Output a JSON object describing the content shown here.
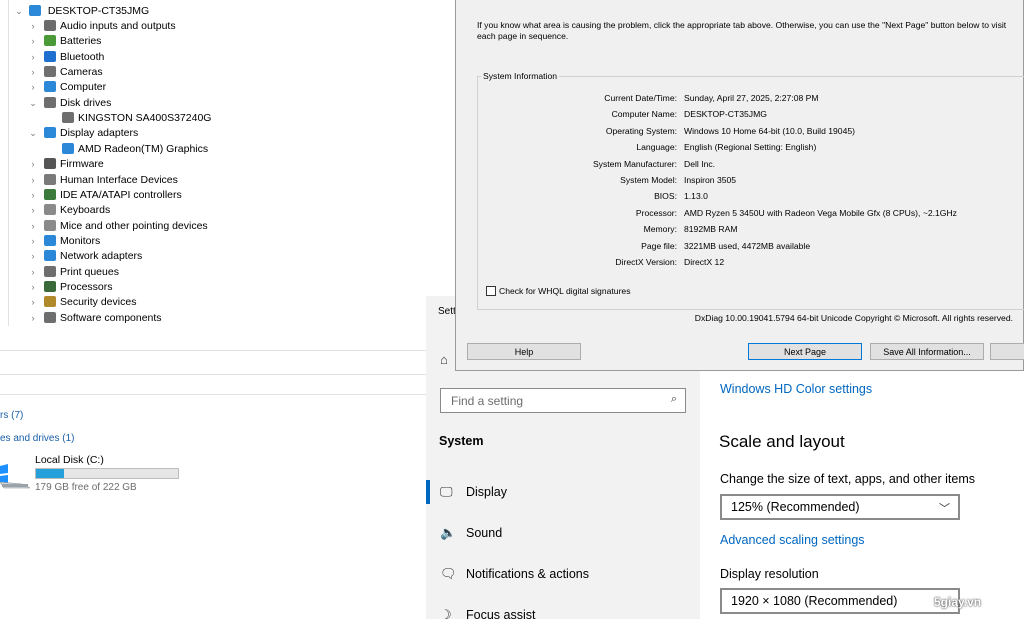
{
  "device_manager": {
    "root": "DESKTOP-CT35JMG",
    "items": [
      {
        "label": "Audio inputs and outputs",
        "chev": "›",
        "indent": 0,
        "color": "#6b6b6b"
      },
      {
        "label": "Batteries",
        "chev": "›",
        "indent": 0,
        "color": "#4a9a3a"
      },
      {
        "label": "Bluetooth",
        "chev": "›",
        "indent": 0,
        "color": "#1f6fd1"
      },
      {
        "label": "Cameras",
        "chev": "›",
        "indent": 0,
        "color": "#707070"
      },
      {
        "label": "Computer",
        "chev": "›",
        "indent": 0,
        "color": "#2b88d8"
      },
      {
        "label": "Disk drives",
        "chev": "⌄",
        "indent": 0,
        "color": "#6e6e6e"
      },
      {
        "label": "KINGSTON SA400S37240G",
        "chev": "",
        "indent": 1,
        "color": "#6e6e6e"
      },
      {
        "label": "Display adapters",
        "chev": "⌄",
        "indent": 0,
        "color": "#2b88d8"
      },
      {
        "label": "AMD Radeon(TM) Graphics",
        "chev": "",
        "indent": 1,
        "color": "#2b88d8"
      },
      {
        "label": "Firmware",
        "chev": "›",
        "indent": 0,
        "color": "#555555"
      },
      {
        "label": "Human Interface Devices",
        "chev": "›",
        "indent": 0,
        "color": "#7a7a7a"
      },
      {
        "label": "IDE ATA/ATAPI controllers",
        "chev": "›",
        "indent": 0,
        "color": "#3a7a3a"
      },
      {
        "label": "Keyboards",
        "chev": "›",
        "indent": 0,
        "color": "#8a8a8a"
      },
      {
        "label": "Mice and other pointing devices",
        "chev": "›",
        "indent": 0,
        "color": "#8a8a8a"
      },
      {
        "label": "Monitors",
        "chev": "›",
        "indent": 0,
        "color": "#2b88d8"
      },
      {
        "label": "Network adapters",
        "chev": "›",
        "indent": 0,
        "color": "#2b88d8"
      },
      {
        "label": "Print queues",
        "chev": "›",
        "indent": 0,
        "color": "#6e6e6e"
      },
      {
        "label": "Processors",
        "chev": "›",
        "indent": 0,
        "color": "#3a6a3a"
      },
      {
        "label": "Security devices",
        "chev": "›",
        "indent": 0,
        "color": "#b08a2a"
      },
      {
        "label": "Software components",
        "chev": "›",
        "indent": 0,
        "color": "#6e6e6e"
      }
    ]
  },
  "explorer": {
    "section_devices": "rs (7)",
    "section_drives": "es and drives (1)",
    "drive_name": "Local Disk (C:)",
    "drive_free": "179 GB free of 222 GB",
    "drive_used_fraction": 0.194
  },
  "settings": {
    "title": "Sett",
    "search_placeholder": "Find a setting",
    "section": "System",
    "nav": [
      {
        "label": "Display",
        "icon": "monitor-icon",
        "glyph": "🖵",
        "active": true
      },
      {
        "label": "Sound",
        "icon": "speaker-icon",
        "glyph": "🔈",
        "active": false
      },
      {
        "label": "Notifications & actions",
        "icon": "notification-icon",
        "glyph": "🗨",
        "active": false
      },
      {
        "label": "Focus assist",
        "icon": "moon-icon",
        "glyph": "☽",
        "active": false
      }
    ],
    "hdr_link": "Windows HD Color settings",
    "scale_heading": "Scale and layout",
    "scale_label": "Change the size of text, apps, and other items",
    "scale_value": "125% (Recommended)",
    "advanced_link": "Advanced scaling settings",
    "resolution_label": "Display resolution",
    "resolution_value": "1920 × 1080 (Recommended)",
    "accent_color": "#0067c0"
  },
  "dxdiag": {
    "intro": "If you know what area is causing the problem, click the appropriate tab above.  Otherwise, you can use the \"Next Page\" button below to visit each page in sequence.",
    "group_title": "System Information",
    "fields": [
      {
        "label": "Current Date/Time:",
        "value": "Sunday, April 27, 2025, 2:27:08 PM"
      },
      {
        "label": "Computer Name:",
        "value": "DESKTOP-CT35JMG"
      },
      {
        "label": "Operating System:",
        "value": "Windows 10 Home 64-bit (10.0, Build 19045)"
      },
      {
        "label": "Language:",
        "value": "English (Regional Setting: English)"
      },
      {
        "label": "System Manufacturer:",
        "value": "Dell Inc."
      },
      {
        "label": "System Model:",
        "value": "Inspiron 3505"
      },
      {
        "label": "BIOS:",
        "value": "1.13.0"
      },
      {
        "label": "Processor:",
        "value": "AMD Ryzen 5 3450U with Radeon Vega Mobile Gfx   (8 CPUs), ~2.1GHz"
      },
      {
        "label": "Memory:",
        "value": "8192MB RAM"
      },
      {
        "label": "Page file:",
        "value": "3221MB used, 4472MB available"
      },
      {
        "label": "DirectX Version:",
        "value": "DirectX 12"
      }
    ],
    "whql_label": "Check for WHQL digital signatures",
    "footer": "DxDiag 10.00.19041.5794 64-bit Unicode  Copyright © Microsoft. All rights reserved.",
    "help_button": "Help",
    "next_button": "Next Page",
    "save_button": "Save All Information..."
  },
  "watermark": "5giay.vn"
}
